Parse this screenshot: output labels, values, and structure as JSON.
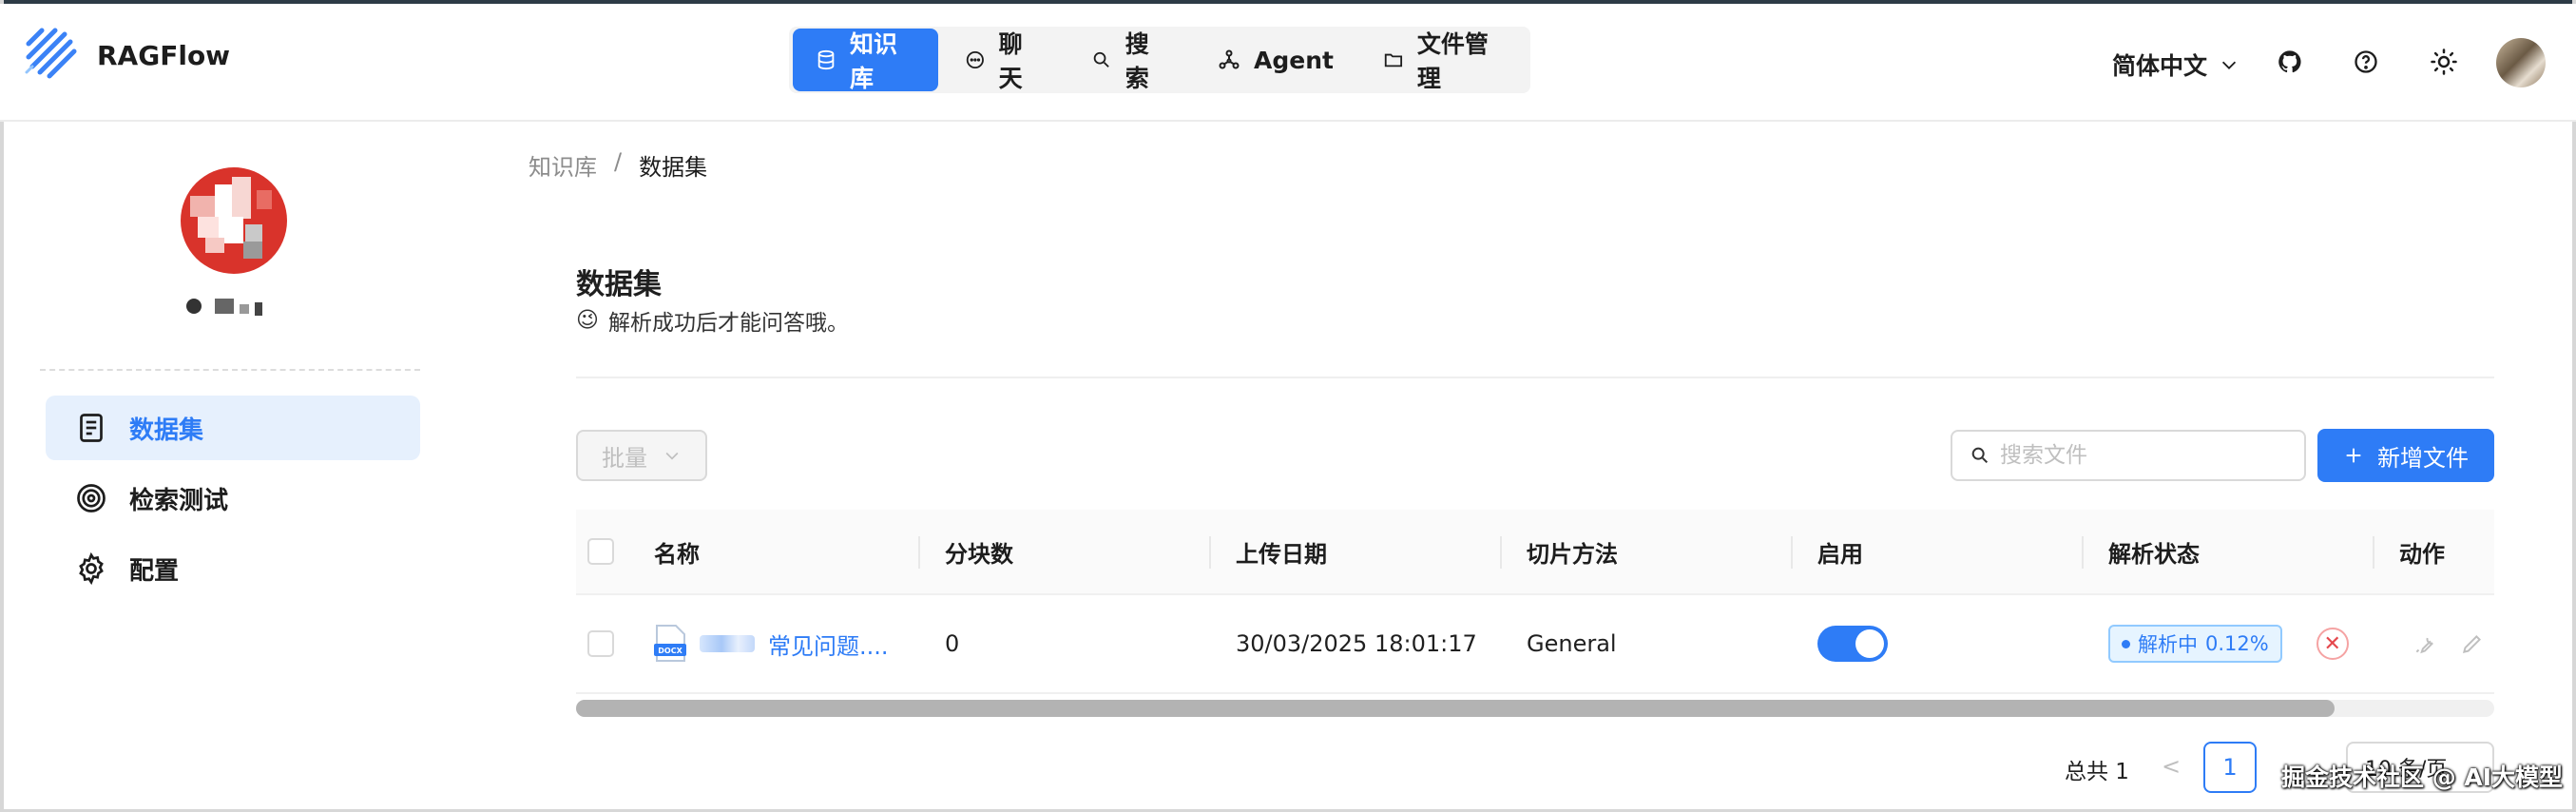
{
  "header": {
    "app_name": "RAGFlow",
    "nav": [
      {
        "label": "知识库",
        "icon": "database-icon",
        "active": true
      },
      {
        "label": "聊天",
        "icon": "chat-bubble-icon",
        "active": false
      },
      {
        "label": "搜索",
        "icon": "search-icon",
        "active": false
      },
      {
        "label": "Agent",
        "icon": "agent-graph-icon",
        "active": false
      },
      {
        "label": "文件管理",
        "icon": "folder-icon",
        "active": false
      }
    ],
    "language": "简体中文",
    "icons": [
      "github-icon",
      "help-icon",
      "theme-sun-icon",
      "user-avatar"
    ]
  },
  "sidebar": {
    "items": [
      {
        "label": "数据集",
        "icon": "dataset-doc-icon",
        "active": true
      },
      {
        "label": "检索测试",
        "icon": "target-icon",
        "active": false
      },
      {
        "label": "配置",
        "icon": "gear-icon",
        "active": false
      }
    ]
  },
  "breadcrumb": {
    "root": "知识库",
    "separator": "/",
    "current": "数据集"
  },
  "main": {
    "title": "数据集",
    "subtitle_emoji": "😉",
    "subtitle": "解析成功后才能问答哦。",
    "batch_label": "批量",
    "search_placeholder": "搜索文件",
    "add_label": "新增文件"
  },
  "table": {
    "columns": [
      "名称",
      "分块数",
      "上传日期",
      "切片方法",
      "启用",
      "解析状态",
      "动作"
    ],
    "rows": [
      {
        "name": "常见问题....",
        "file_type": "DOCX",
        "chunks": "0",
        "upload_date": "30/03/2025 18:01:17",
        "chunk_method": "General",
        "enabled": true,
        "status_label": "解析中",
        "status_progress": "0.12%"
      }
    ]
  },
  "pagination": {
    "total_label": "总共 1",
    "current_page": "1",
    "page_size": "10 条/页"
  },
  "watermark": "掘金技术社区 @ AI大模型",
  "colors": {
    "accent": "#2e7cf6",
    "active_bg": "#e6f0fd",
    "danger": "#e5484d"
  }
}
